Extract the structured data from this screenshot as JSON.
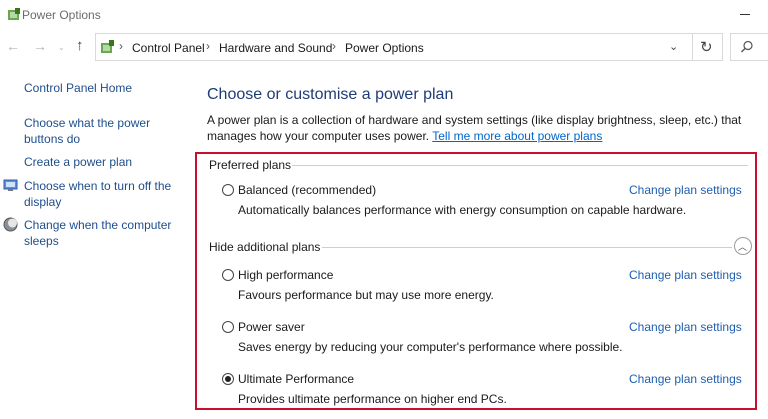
{
  "window": {
    "title": "Power Options"
  },
  "navigation": {
    "back_icon": "←",
    "forward_icon": "→",
    "recent_icon": "⌄",
    "up_icon": "↑",
    "breadcrumb": [
      "Control Panel",
      "Hardware and Sound",
      "Power Options"
    ],
    "separator": "›",
    "dropdown_icon": "⌄",
    "refresh_icon": "↻"
  },
  "sidebar": {
    "items": [
      {
        "label": "Control Panel Home"
      },
      {
        "label": "Choose what the power buttons do"
      },
      {
        "label": "Create a power plan"
      },
      {
        "label": "Choose when to turn off the display"
      },
      {
        "label": "Change when the computer sleeps"
      }
    ]
  },
  "main": {
    "title": "Choose or customise a power plan",
    "description": "A power plan is a collection of hardware and system settings (like display brightness, sleep, etc.) that manages how your computer uses power. ",
    "description_link": "Tell me more about power plans",
    "preferred_header": "Preferred plans",
    "additional_header": "Hide additional plans",
    "collapse_icon": "︿",
    "plans": [
      {
        "name": "Balanced (recommended)",
        "description": "Automatically balances performance with energy consumption on capable hardware.",
        "link": "Change plan settings",
        "selected": false
      },
      {
        "name": "High performance",
        "description": "Favours performance but may use more energy.",
        "link": "Change plan settings",
        "selected": false
      },
      {
        "name": "Power saver",
        "description": "Saves energy by reducing your computer's performance where possible.",
        "link": "Change plan settings",
        "selected": false
      },
      {
        "name": "Ultimate Performance",
        "description": "Provides ultimate performance on higher end PCs.",
        "link": "Change plan settings",
        "selected": true
      }
    ]
  },
  "colors": {
    "title_blue": "#1e3d76",
    "link_blue": "#0066cc",
    "highlight_red": "#c8102e"
  }
}
